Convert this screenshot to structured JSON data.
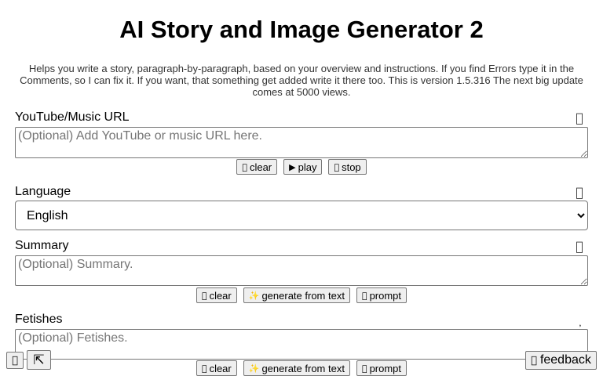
{
  "title": "AI Story and Image Generator 2",
  "description": "Helps you write a story, paragraph-by-paragraph, based on your overview and instructions. If you find Errors type it in the Comments, so I can fix it. If you want, that something get added write it there too. This is version 1.5.316 The next big update comes at 5000 views.",
  "youtube": {
    "label": "YouTube/Music URL",
    "icon": "",
    "placeholder": "(Optional) Add YouTube or music URL here.",
    "clear_icon": "",
    "clear_label": "clear",
    "play_icon": "▶",
    "play_label": "play",
    "stop_icon": "",
    "stop_label": "stop"
  },
  "language": {
    "label": "Language",
    "icon": "",
    "selected": "English"
  },
  "summary": {
    "label": "Summary",
    "icon": "",
    "placeholder": "(Optional) Summary.",
    "clear_icon": "",
    "clear_label": "clear",
    "generate_icon": "✨",
    "generate_label": "generate from text",
    "prompt_icon": "",
    "prompt_label": "prompt"
  },
  "fetishes": {
    "label": "Fetishes",
    "icon": "",
    "placeholder": "(Optional) Fetishes.",
    "clear_icon": "",
    "clear_label": "clear",
    "generate_icon": "✨",
    "generate_label": "generate from text",
    "prompt_icon": "",
    "prompt_label": "prompt"
  },
  "floating": {
    "menu_icon": "",
    "expand_icon": "⇱",
    "feedback_icon": "",
    "feedback_label": "feedback"
  }
}
